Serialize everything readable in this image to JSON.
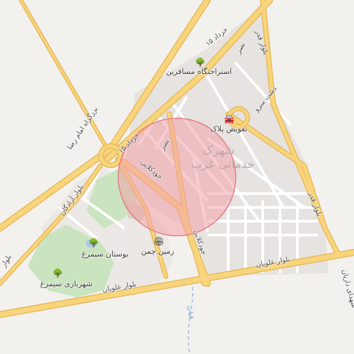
{
  "map": {
    "colors": {
      "land": "#f3f1ee",
      "urban": "#e6e3e0",
      "park": "#c9e4bf",
      "road_fill": "#f8d57c",
      "road_casing": "#e7b95b",
      "minor_road": "#ffffff",
      "water": "#a8c8ef",
      "highlight_fill": "#f2a3aa",
      "highlight_stroke": "#e57c86"
    },
    "district_label": [
      "شهرک",
      "خدماتی غرب"
    ],
    "roads": {
      "khordad_top": "۱۵ خرداد",
      "khordad_mid": "۱۵ خرداد",
      "nasr_top": "نصر",
      "nasr_mid": "نصر",
      "qaem": "بلوار قدر",
      "qaem_lower": "بلوار قدر",
      "dashte": "دشت سرو",
      "emam_reza": "بزرگراه امام رضا",
      "azadegan": "بلوار آزادگان",
      "alavian_left": "بلوار علویان",
      "alavian_right": "بلوار علویان",
      "goodkalaee_upper": "جودکلایی",
      "goodkalaee_lower": "جودکلایی",
      "shohada": "شهدای داریان",
      "canal": "قنات",
      "left_edge": "بلوار"
    },
    "pois": {
      "rest_area": {
        "label": "استراحتگاه مسافرین",
        "icon": "tree-icon"
      },
      "plate_change": {
        "label": "تعویض پلاک",
        "icon": "car-icon"
      },
      "simorgh_park": {
        "label": "بوستان سیمرغ",
        "icon": "tree-icon"
      },
      "zamin_chaman": {
        "label": "زمین چمن",
        "icon": "stadium-icon"
      },
      "shahrbazi": {
        "label": "شهربازی سیمرغ",
        "icon": "tree-icon"
      }
    }
  }
}
